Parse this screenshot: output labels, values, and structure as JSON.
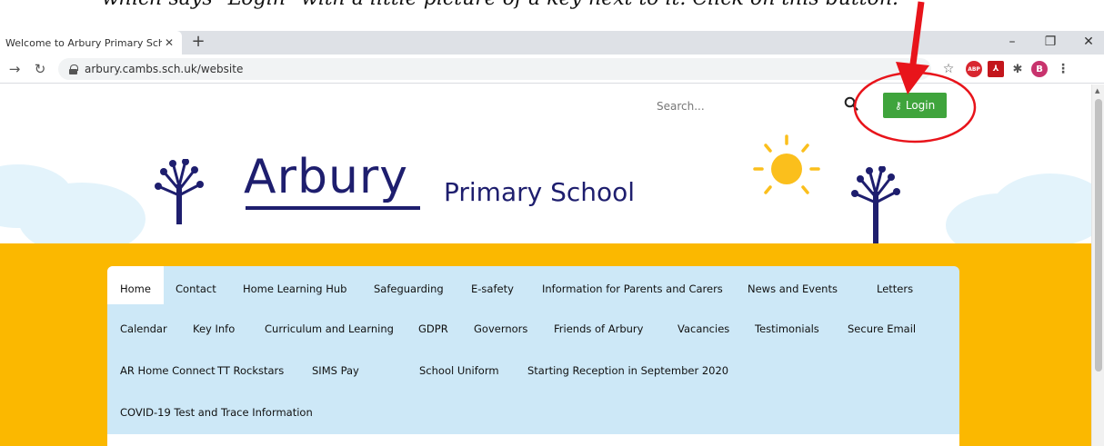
{
  "caption": {
    "text": "which says \"Login\" with a little picture of a key next to it. Click on this button."
  },
  "browser": {
    "tab_title": "Welcome to Arbury Primary Scho",
    "tab_close": "✕",
    "new_tab": "+",
    "url": "arbury.cambs.sch.uk/website",
    "window_controls": {
      "minimize": "–",
      "restore": "❐",
      "close": "✕"
    },
    "profile_initial": "B",
    "extensions": {
      "adblock": "ABP",
      "pdf": "⅄"
    }
  },
  "site": {
    "search_placeholder": "Search...",
    "login_label": "Login",
    "logo_main": "Arbury",
    "logo_sub": "Primary School"
  },
  "nav": {
    "items": [
      "Home",
      "Contact",
      "Home Learning Hub",
      "Safeguarding",
      "E-safety",
      "Information for Parents and Carers",
      "News and Events",
      "Letters",
      "Calendar",
      "Key Info",
      "Curriculum and Learning",
      "GDPR",
      "Governors",
      "Friends of Arbury",
      "Vacancies",
      "Testimonials",
      "Secure Email",
      "AR Home Connect",
      "TT Rockstars",
      "SIMS Pay",
      "School Uniform",
      "Starting Reception in September 2020",
      "COVID-19 Test and Trace Information"
    ]
  },
  "colors": {
    "login_green": "#3fa43c",
    "banner_orange": "#fbb800",
    "nav_blue": "#cde8f7",
    "logo_navy": "#1e1e6e",
    "annotation_red": "#e8141b"
  }
}
